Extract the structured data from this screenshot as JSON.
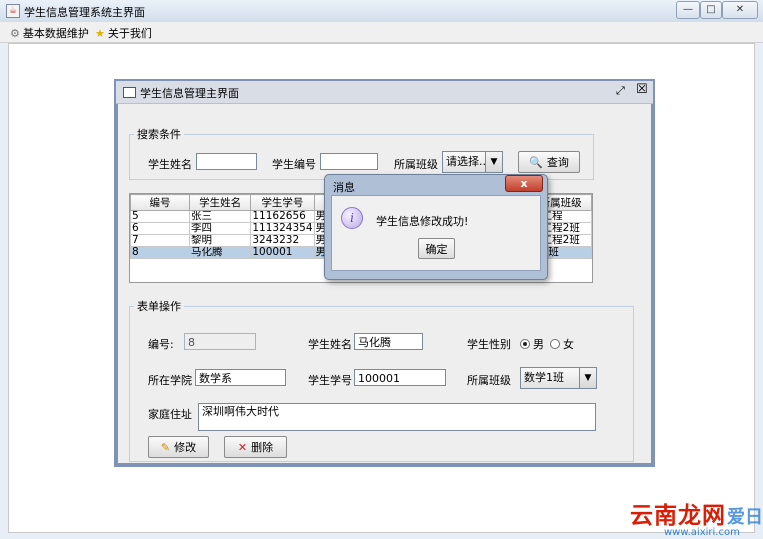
{
  "window": {
    "title": "学生信息管理系统主界面",
    "controls": [
      "—",
      "□",
      "✕"
    ]
  },
  "menubar": {
    "items": [
      {
        "label": "基本数据维护",
        "icon": "gear-icon"
      },
      {
        "label": "关于我们",
        "icon": "star-icon"
      }
    ]
  },
  "inner_frame": {
    "title": "学生信息管理主界面",
    "controls": [
      "⤢",
      "☒"
    ]
  },
  "search": {
    "legend": "搜索条件",
    "name_label": "学生姓名",
    "name_value": "",
    "number_label": "学生编号",
    "number_value": "",
    "class_label": "所属班级",
    "class_value": "请选择...",
    "query_button": "查询"
  },
  "table": {
    "columns": [
      "编号",
      "学生姓名",
      "学生学号",
      "",
      "",
      "所属班级"
    ],
    "rows": [
      {
        "cells": [
          "5",
          "张三",
          "11162656",
          "男",
          "",
          "件工程"
        ],
        "selected": false
      },
      {
        "cells": [
          "6",
          "李四",
          "111324354",
          "男",
          "",
          "件工程2班"
        ],
        "selected": false
      },
      {
        "cells": [
          "7",
          "黎明",
          "3243232",
          "男",
          "",
          "件工程2班"
        ],
        "selected": false
      },
      {
        "cells": [
          "8",
          "马化腾",
          "100001",
          "男",
          "",
          "学1班"
        ],
        "selected": true
      }
    ]
  },
  "dialog": {
    "title": "消息",
    "message": "学生信息修改成功!",
    "ok_button": "确定",
    "close_glyph": "x"
  },
  "form": {
    "legend": "表单操作",
    "id_label": "编号:",
    "id_value": "8",
    "name_label": "学生姓名",
    "name_value": "马化腾",
    "gender_label": "学生性别",
    "gender_male": "男",
    "gender_female": "女",
    "gender_selected": "男",
    "school_label": "所在学院",
    "school_value": "数学系",
    "number_label": "学生学号",
    "number_value": "100001",
    "class_label": "所属班级",
    "class_value": "数学1班",
    "address_label": "家庭住址",
    "address_value": "深圳啊伟大时代",
    "edit_button": "修改",
    "delete_button": "删除"
  },
  "watermark": {
    "text": "云南龙网",
    "sub": "www.aixiri.com",
    "corner": "爱日"
  },
  "colors": {
    "selection": "#b8cfe5",
    "frame_border": "#7f93b6",
    "close_red": "#c0402c"
  }
}
